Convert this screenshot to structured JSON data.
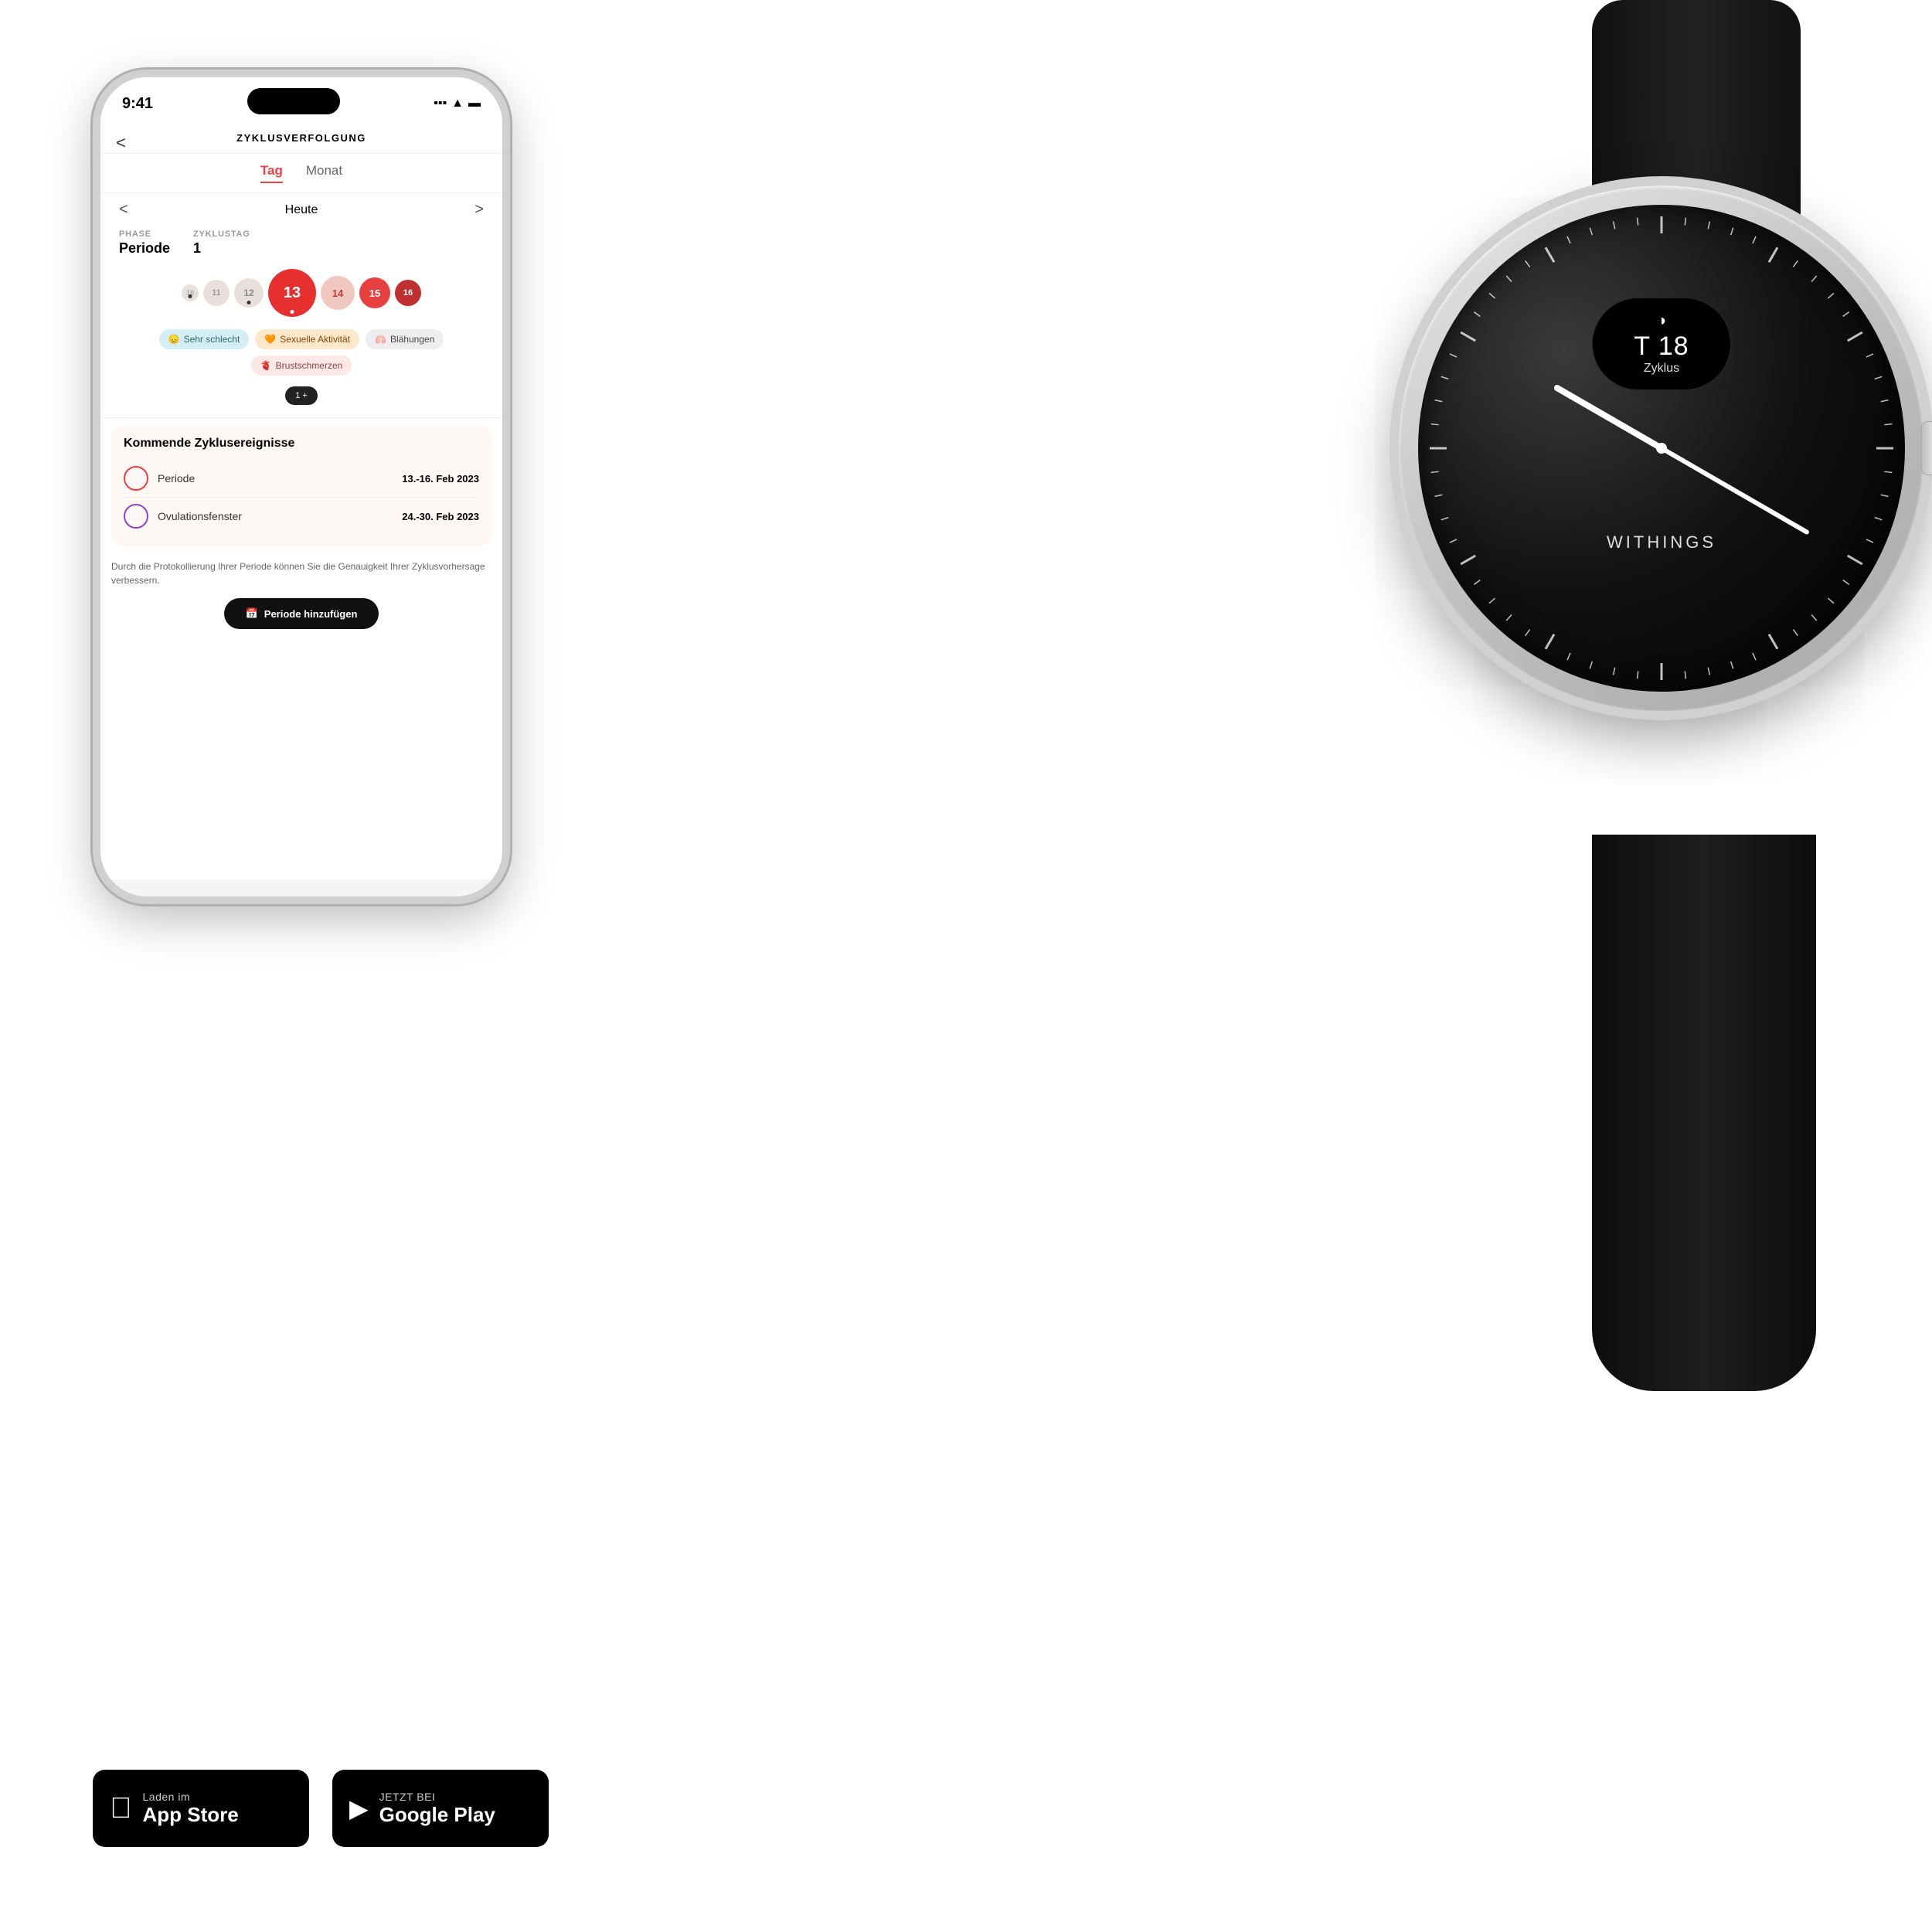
{
  "background": "#ffffff",
  "phone": {
    "status_time": "9:41",
    "app_title": "ZYKLUSVERFOLGUNG",
    "back_arrow": "<",
    "tabs": [
      {
        "label": "Tag",
        "active": true
      },
      {
        "label": "Monat",
        "active": false
      }
    ],
    "nav": {
      "left": "<",
      "center": "Heute",
      "right": ">"
    },
    "phase_label": "PHASE",
    "phase_value": "Periode",
    "zyklustag_label": "ZYKLUSTAG",
    "zyklustag_value": "1",
    "cycle_days": [
      {
        "num": "10",
        "size": "tiny"
      },
      {
        "num": "11",
        "size": "sm"
      },
      {
        "num": "12",
        "size": "md"
      },
      {
        "num": "13",
        "size": "xl",
        "indicator": true
      },
      {
        "num": "14",
        "size": "lg"
      },
      {
        "num": "15",
        "size": "red-md"
      },
      {
        "num": "16",
        "size": "dark-red"
      }
    ],
    "symptoms": [
      {
        "label": "Sehr schlecht",
        "type": "blue"
      },
      {
        "label": "Sexuelle Aktivität",
        "type": "orange"
      },
      {
        "label": "Blähungen",
        "type": "gray"
      },
      {
        "label": "Brustschmerzen",
        "type": "pink"
      }
    ],
    "upcoming_title": "Kommende Zyklusereignisse",
    "events": [
      {
        "name": "Periode",
        "date": "13.-16. Feb 2023",
        "icon_type": "red"
      },
      {
        "name": "Ovulationsfenster",
        "date": "24.-30. Feb 2023",
        "icon_type": "purple"
      }
    ],
    "info_text": "Durch die Protokollierung Ihrer Periode können Sie die Genauigkeit Ihrer Zyklusvorhersage verbessern.",
    "add_period_btn": "Periode hinzufügen"
  },
  "watch": {
    "display_temp": "T 18",
    "display_label": "Zyklus",
    "brand": "WITHINGS"
  },
  "badges": {
    "apple": {
      "sub_label": "Laden im",
      "main_label": "App Store"
    },
    "google": {
      "sub_label": "JETZT BEI",
      "main_label": "Google Play"
    }
  }
}
